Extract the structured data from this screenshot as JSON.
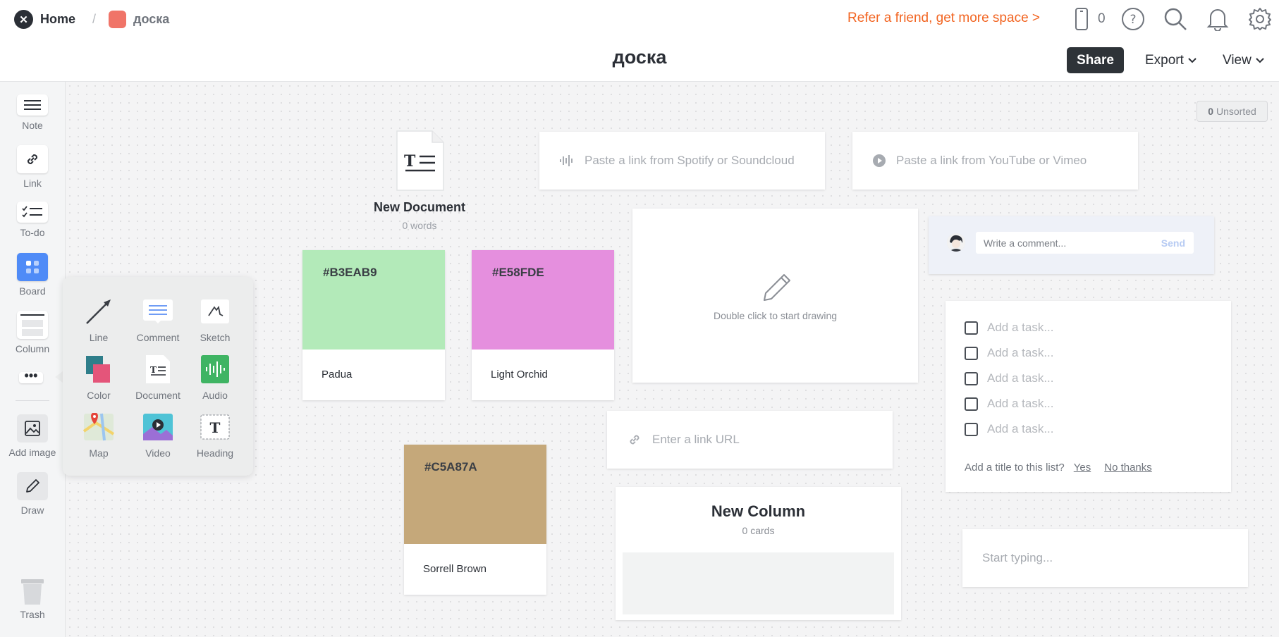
{
  "header": {
    "home_label": "Home",
    "separator": "/",
    "board_crumb": "доска",
    "refer_text": "Refer a friend, get more space >",
    "device_count": "0",
    "board_title": "доска",
    "share_label": "Share",
    "export_label": "Export",
    "view_label": "View"
  },
  "sidebar": {
    "note": "Note",
    "link": "Link",
    "todo": "To-do",
    "board": "Board",
    "column": "Column",
    "more": "•••",
    "add_image": "Add image",
    "draw": "Draw",
    "trash": "Trash"
  },
  "popup": {
    "line": "Line",
    "comment": "Comment",
    "sketch": "Sketch",
    "color": "Color",
    "document": "Document",
    "audio": "Audio",
    "map": "Map",
    "video": "Video",
    "heading": "Heading"
  },
  "canvas": {
    "unsorted_count": "0",
    "unsorted_label": "Unsorted",
    "document": {
      "title": "New Document",
      "subtitle": "0 words"
    },
    "audio_placeholder": "Paste a link from Spotify or Soundcloud",
    "video_placeholder": "Paste a link from YouTube or Vimeo",
    "colors": [
      {
        "hex": "#B3EAB9",
        "name": "Padua"
      },
      {
        "hex": "#E58FDE",
        "name": "Light Orchid"
      },
      {
        "hex": "#C5A87A",
        "name": "Sorrell Brown"
      }
    ],
    "draw_hint": "Double click to start drawing",
    "comment": {
      "placeholder": "Write a comment...",
      "send": "Send"
    },
    "todo": {
      "task_placeholder": "Add a task...",
      "title_prompt": "Add a title to this list?",
      "yes": "Yes",
      "no": "No thanks"
    },
    "link_placeholder": "Enter a link URL",
    "column": {
      "title": "New Column",
      "subtitle": "0 cards"
    },
    "note_placeholder": "Start typing..."
  }
}
